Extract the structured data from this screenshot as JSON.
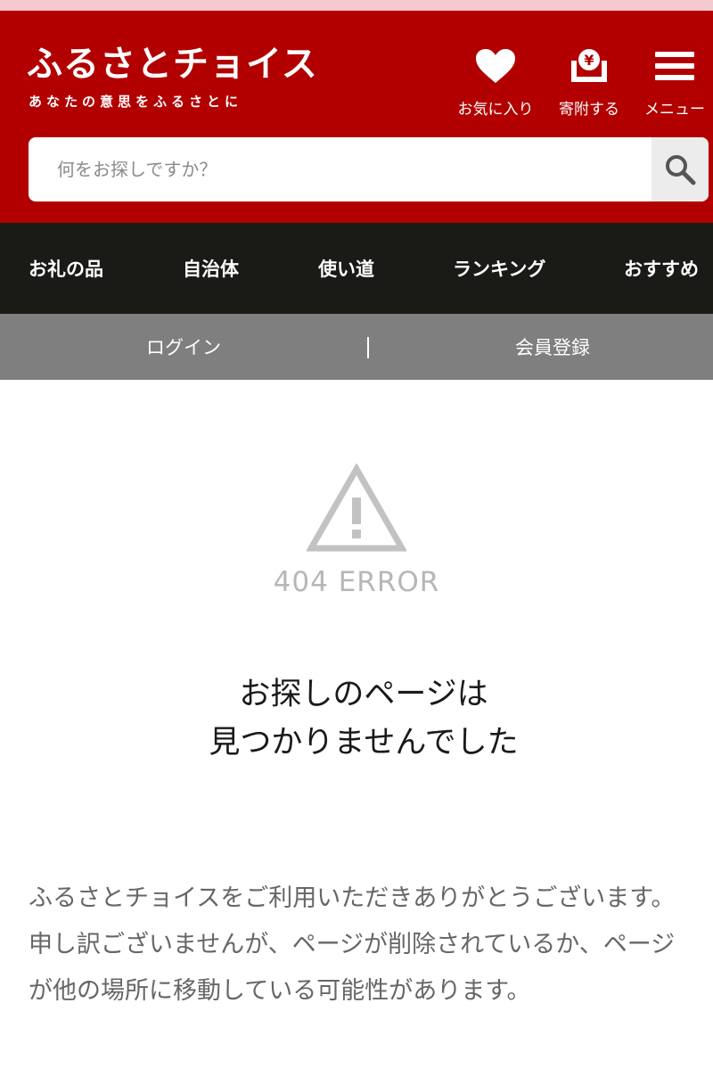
{
  "header": {
    "logo_title": "ふるさとチョイス",
    "logo_tagline": "あなたの意思をふるさとに",
    "actions": {
      "favorites_label": "お気に入り",
      "donate_label": "寄附する",
      "menu_label": "メニュー"
    },
    "brand_color": "#b20000"
  },
  "search": {
    "placeholder": "何をお探しですか？"
  },
  "nav": {
    "items": [
      {
        "label": "お礼の品"
      },
      {
        "label": "自治体"
      },
      {
        "label": "使い道"
      },
      {
        "label": "ランキング"
      },
      {
        "label": "おすすめ"
      }
    ]
  },
  "auth": {
    "login_label": "ログイン",
    "register_label": "会員登録"
  },
  "error": {
    "icon": "warning-triangle-icon",
    "code": "404 ERROR",
    "title_line1": "お探しのページは",
    "title_line2": "見つかりませんでした",
    "message_line1": "ふるさとチョイスをご利用いただきありがとうございます。",
    "message_line2": "申し訳ございませんが、ページが削除されているか、ページが他の場所に移動している可能性があります。"
  }
}
